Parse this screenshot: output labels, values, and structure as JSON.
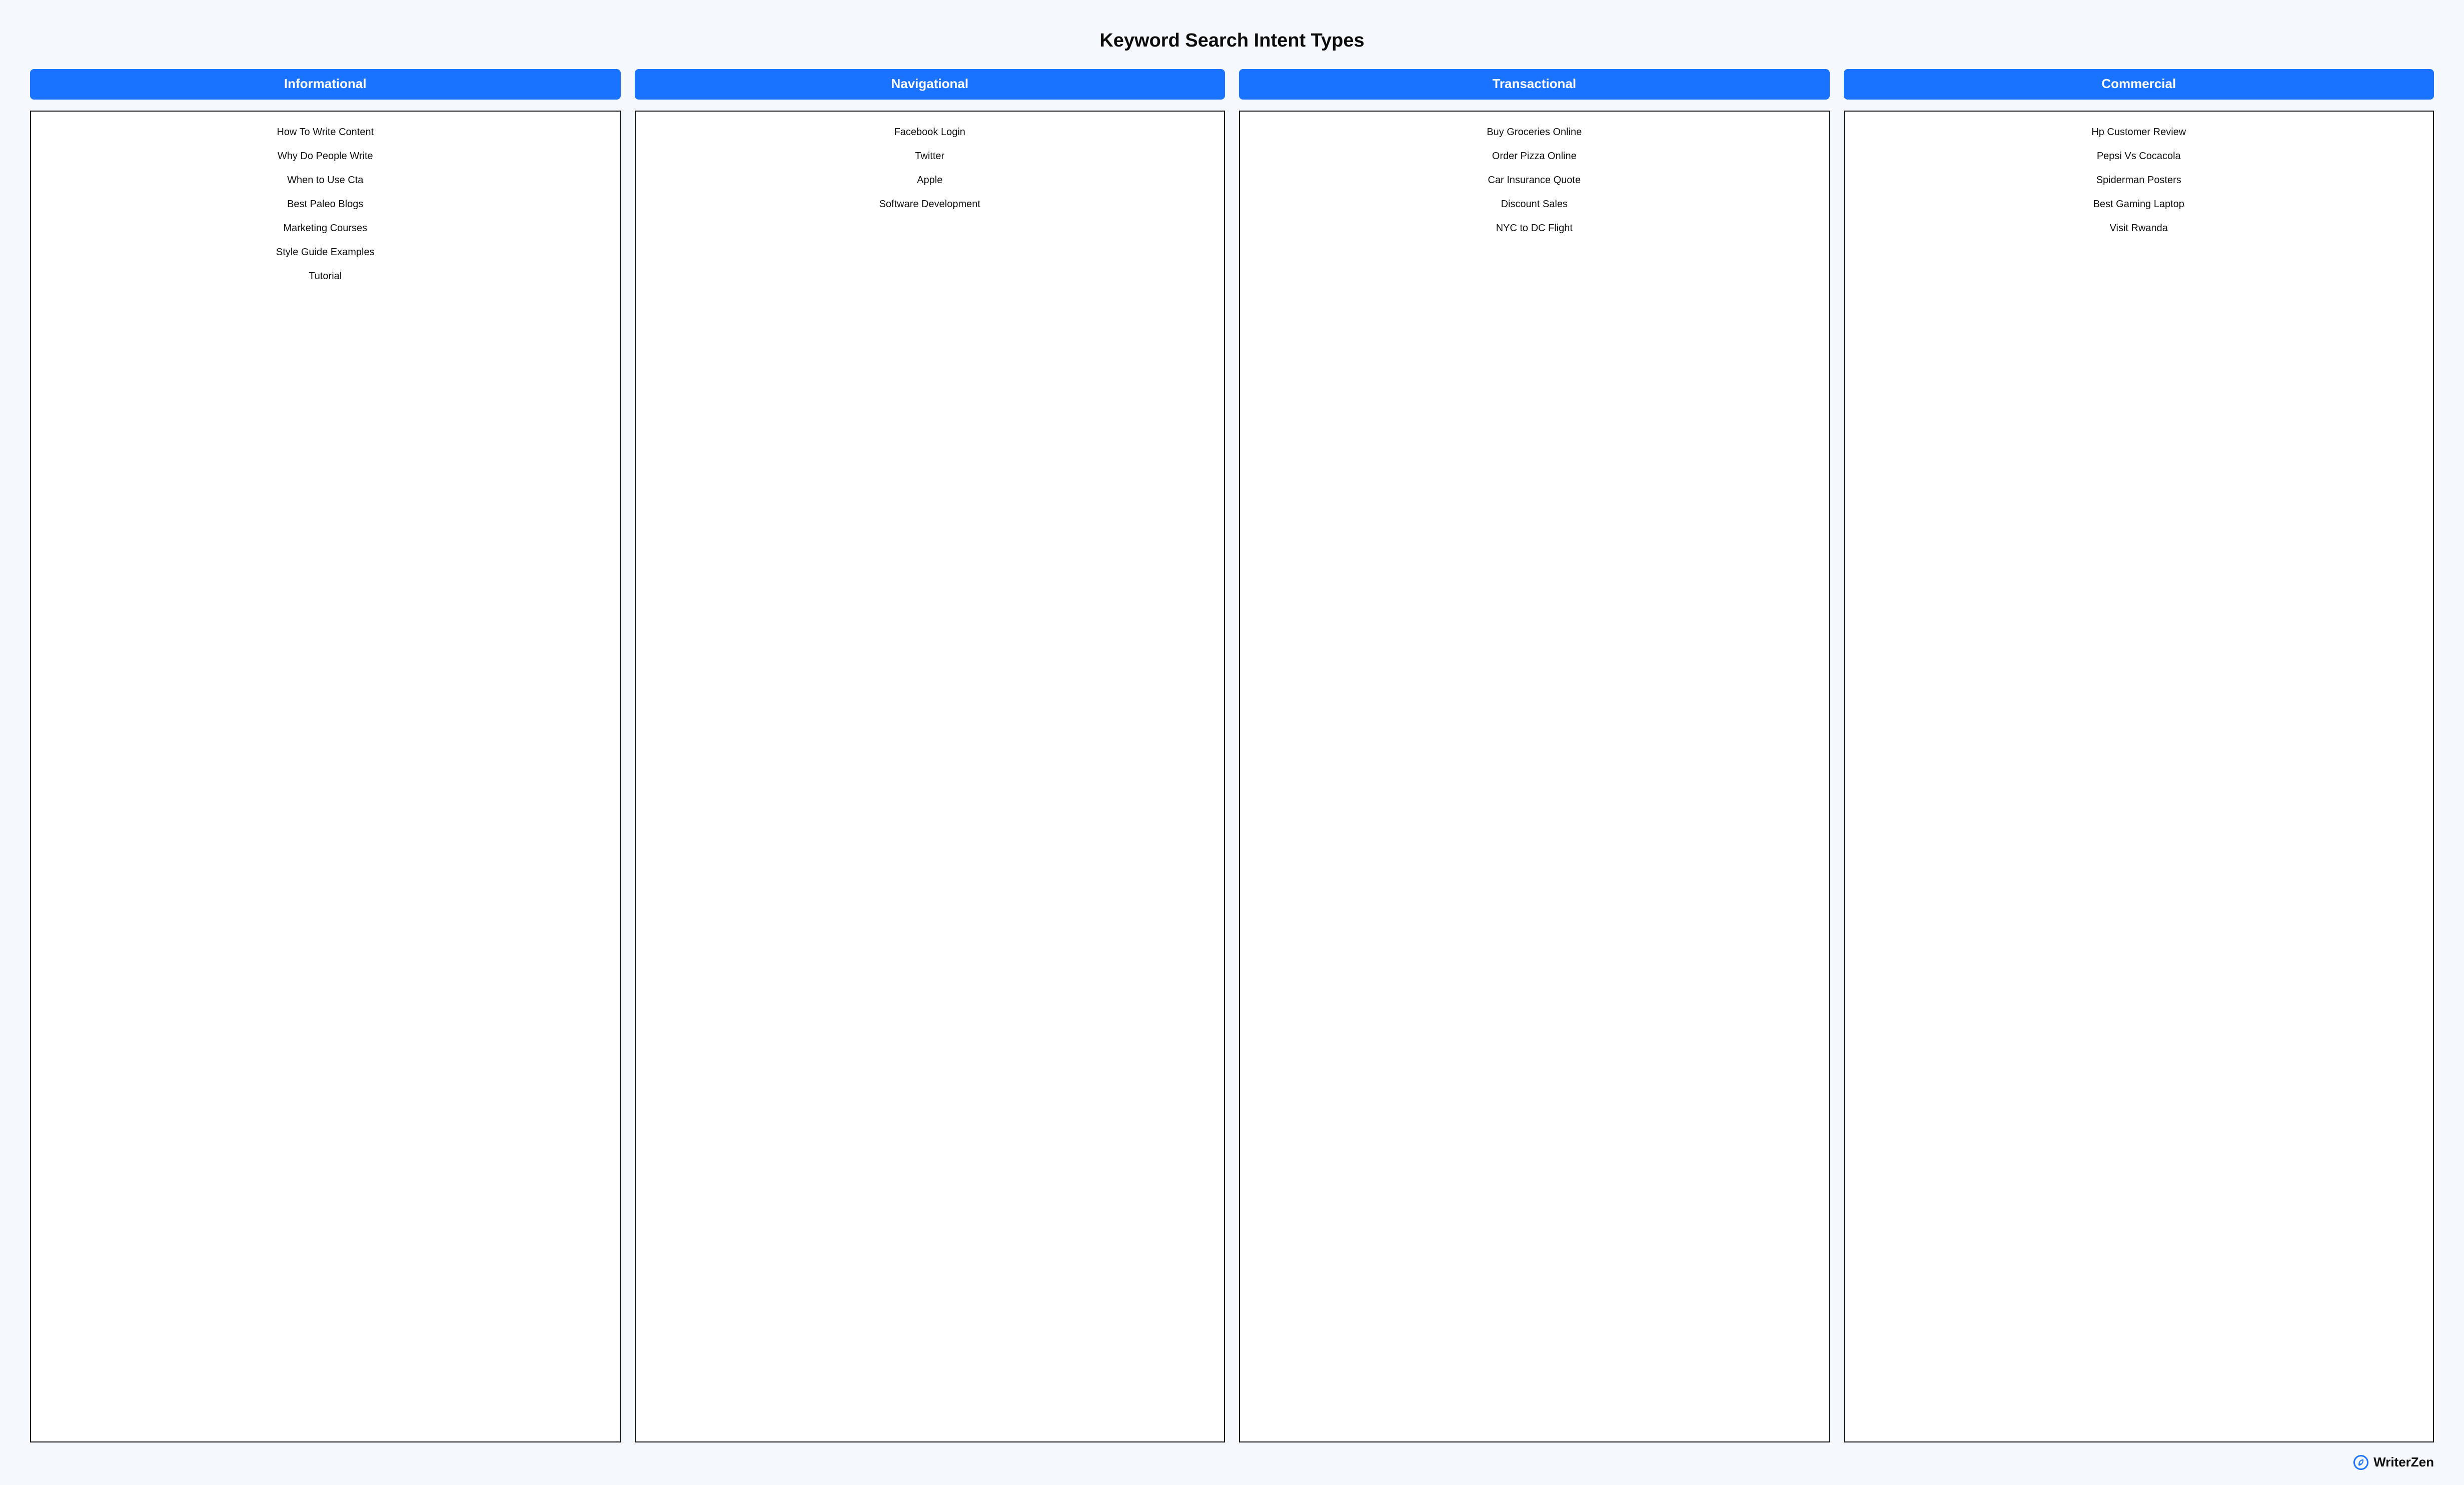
{
  "title": "Keyword Search Intent Types",
  "columns": [
    {
      "label": "Informational",
      "slug": "informational",
      "items": [
        "How To Write Content",
        "Why Do People Write",
        "When to Use Cta",
        "Best Paleo Blogs",
        "Marketing Courses",
        "Style Guide Examples",
        "Tutorial"
      ]
    },
    {
      "label": "Navigational",
      "slug": "navigational",
      "items": [
        "Facebook Login",
        "Twitter",
        "Apple",
        "Software Development"
      ]
    },
    {
      "label": "Transactional",
      "slug": "transactional",
      "items": [
        "Buy Groceries Online",
        "Order Pizza Online",
        "Car Insurance Quote",
        "Discount Sales",
        "NYC to DC Flight"
      ]
    },
    {
      "label": "Commercial",
      "slug": "commercial",
      "items": [
        "Hp Customer Review",
        "Pepsi Vs Cocacola",
        "Spiderman Posters",
        "Best Gaming Laptop",
        "Visit Rwanda"
      ]
    }
  ],
  "brand": {
    "name": "WriterZen",
    "accent": "#1a73ff"
  }
}
